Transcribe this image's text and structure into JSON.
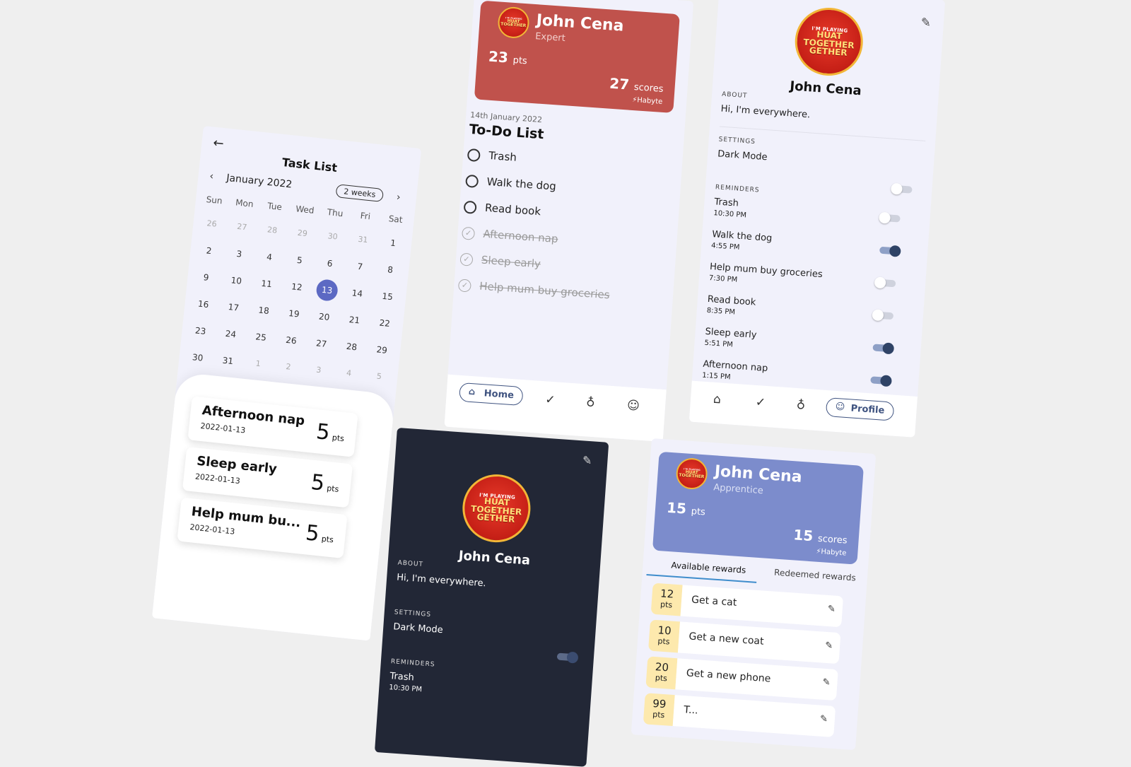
{
  "task_list": {
    "title": "Task List",
    "month": "January 2022",
    "range_btn": "2 weeks",
    "weekdays": [
      "Sun",
      "Mon",
      "Tue",
      "Wed",
      "Thu",
      "Fri",
      "Sat"
    ],
    "weeks": [
      [
        "26",
        "27",
        "28",
        "29",
        "30",
        "31",
        "1"
      ],
      [
        "2",
        "3",
        "4",
        "5",
        "6",
        "7",
        "8"
      ],
      [
        "9",
        "10",
        "11",
        "12",
        "13",
        "14",
        "15"
      ],
      [
        "16",
        "17",
        "18",
        "19",
        "20",
        "21",
        "22"
      ],
      [
        "23",
        "24",
        "25",
        "26",
        "27",
        "28",
        "29"
      ],
      [
        "30",
        "31",
        "1",
        "2",
        "3",
        "4",
        "5"
      ]
    ],
    "selected_day": "13",
    "tasks": [
      {
        "name": "Afternoon nap",
        "date": "2022-01-13",
        "pts": "5",
        "unit": "pts"
      },
      {
        "name": "Sleep early",
        "date": "2022-01-13",
        "pts": "5",
        "unit": "pts"
      },
      {
        "name": "Help mum bu...",
        "date": "2022-01-13",
        "pts": "5",
        "unit": "pts"
      }
    ]
  },
  "home": {
    "header": {
      "name": "John Cena",
      "rank": "Expert",
      "pts": "23",
      "pts_unit": "pts",
      "scores": "27",
      "scores_unit": "scores",
      "brand": "Habyte",
      "color": "#c0524c"
    },
    "date": "14th January 2022",
    "title": "To-Do List",
    "items": [
      {
        "label": "Trash",
        "done": false
      },
      {
        "label": "Walk the dog",
        "done": false
      },
      {
        "label": "Read book",
        "done": false
      },
      {
        "label": "Afternoon nap",
        "done": true
      },
      {
        "label": "Sleep early",
        "done": true
      },
      {
        "label": "Help mum buy groceries",
        "done": true
      }
    ],
    "nav": {
      "home": "Home"
    }
  },
  "profile": {
    "badge": {
      "small": "I'M PLAYING",
      "big1": "HUAT",
      "big2": "TOGETHER",
      "big3": "GETHER"
    },
    "name": "John Cena",
    "about_label": "ABOUT",
    "about": "Hi, I'm everywhere.",
    "settings_label": "SETTINGS",
    "dark_mode": "Dark Mode",
    "reminders_label": "REMINDERS",
    "reminders": [
      {
        "name": "Trash",
        "time": "10:30 PM",
        "on": false
      },
      {
        "name": "Walk the dog",
        "time": "4:55 PM",
        "on": true
      },
      {
        "name": "Help mum buy groceries",
        "time": "7:30 PM",
        "on": false
      },
      {
        "name": "Read book",
        "time": "8:35 PM",
        "on": false
      },
      {
        "name": "Sleep early",
        "time": "5:51 PM",
        "on": true
      },
      {
        "name": "Afternoon nap",
        "time": "1:15 PM",
        "on": true
      }
    ],
    "nav": {
      "profile": "Profile"
    }
  },
  "dark_profile": {
    "name": "John Cena",
    "about_label": "ABOUT",
    "about": "Hi, I'm everywhere.",
    "settings_label": "SETTINGS",
    "dark_mode": "Dark Mode",
    "reminders_label": "REMINDERS",
    "reminder_name": "Trash",
    "reminder_time": "10:30 PM"
  },
  "rewards": {
    "header": {
      "name": "John Cena",
      "rank": "Apprentice",
      "pts": "15",
      "pts_unit": "pts",
      "scores": "15",
      "scores_unit": "scores",
      "brand": "Habyte",
      "color": "#7c8ccc"
    },
    "tab_available": "Available rewards",
    "tab_redeemed": "Redeemed rewards",
    "items": [
      {
        "pts": "12",
        "unit": "pts",
        "name": "Get a cat"
      },
      {
        "pts": "10",
        "unit": "pts",
        "name": "Get a new coat"
      },
      {
        "pts": "20",
        "unit": "pts",
        "name": "Get a new phone"
      },
      {
        "pts": "99",
        "unit": "pts",
        "name": "T..."
      }
    ]
  },
  "colors": {
    "accent": "#5c69c3",
    "dark_bg": "#222736",
    "phone_bg": "#f1f1fb",
    "reward_pts_bg": "#fde9ad"
  }
}
